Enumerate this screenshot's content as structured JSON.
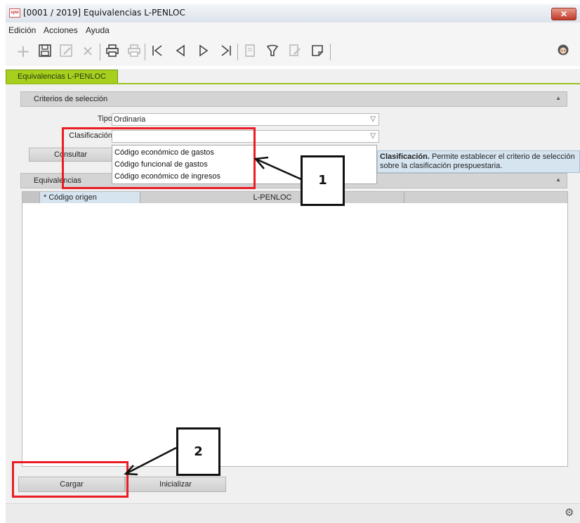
{
  "window": {
    "title": "[0001 / 2019] Equivalencias L-PENLOC",
    "app_icon_text": "spw",
    "close_symbol": "✕"
  },
  "menu": {
    "items": [
      "Edición",
      "Acciones",
      "Ayuda"
    ]
  },
  "toolbar": {
    "icons": [
      "plus-icon",
      "save-icon",
      "edit-icon",
      "delete-icon",
      "print-icon",
      "print-preview-icon",
      "first-record-icon",
      "prev-record-icon",
      "next-record-icon",
      "last-record-icon",
      "document-icon",
      "filter-icon",
      "report-icon",
      "note-icon"
    ],
    "user_icon": "user-icon"
  },
  "tabs": [
    {
      "label": "Equivalencias L-PENLOC",
      "active": true
    }
  ],
  "criterios": {
    "title": "Criterios de selección",
    "tipo_label": "Tipo",
    "tipo_value": "Ordinaria",
    "clasificacion_label": "Clasificación",
    "clasificacion_value": "",
    "consultar_label": "Consultar",
    "dropdown_options": [
      "Código económico de gastos",
      "Código funcional de gastos",
      "Código económico de ingresos"
    ]
  },
  "tooltip": {
    "bold": "Clasificación.",
    "text": " Permite establecer el criterio de selección sobre la clasificación prespuestaria."
  },
  "equivalencias": {
    "title": "Equivalencias",
    "columns": [
      "* Código origen",
      "L-PENLOC",
      ""
    ]
  },
  "buttons": {
    "cargar": "Cargar",
    "inicializar": "Inicializar"
  },
  "annotations": {
    "callout_1": "1",
    "callout_2": "2"
  },
  "colors": {
    "tab_accent": "#a8cf1e",
    "highlight_red": "#ea1c24",
    "tooltip_bg": "#d6e4f0"
  }
}
